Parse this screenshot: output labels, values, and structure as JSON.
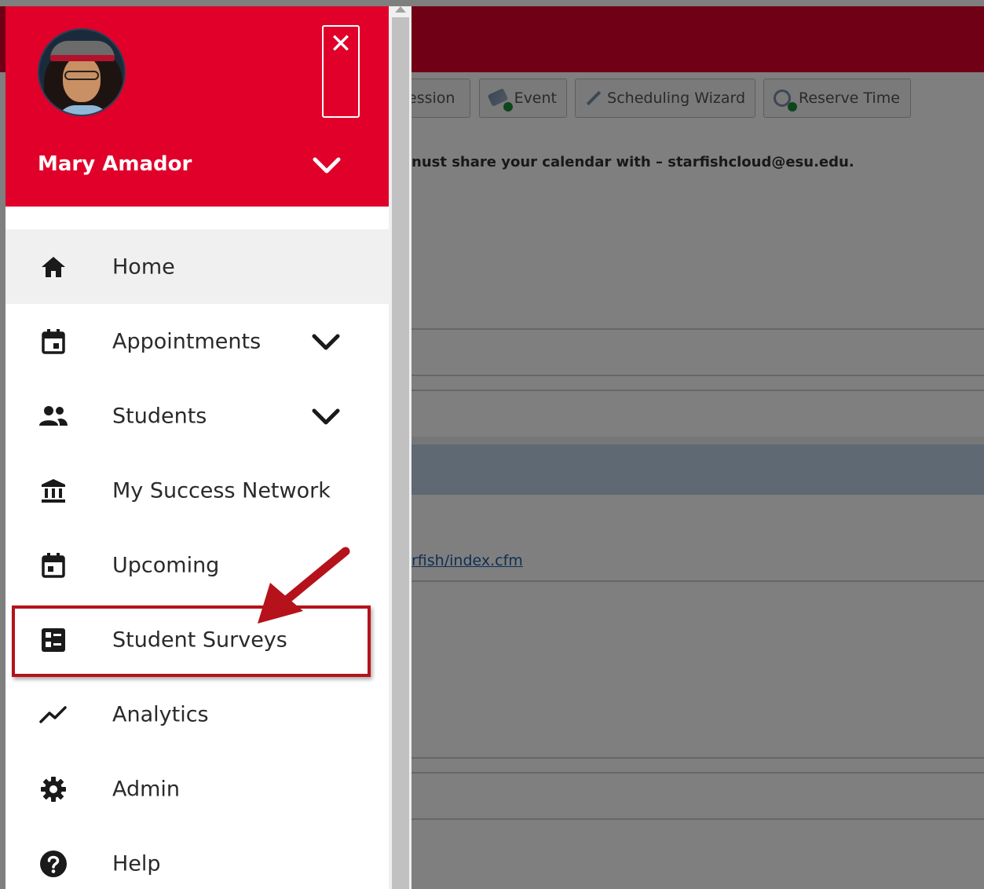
{
  "background": {
    "toolbar": [
      {
        "label": "ession",
        "icon": "session-icon"
      },
      {
        "label": "Event",
        "icon": "event-icon"
      },
      {
        "label": "Scheduling Wizard",
        "icon": "wand-icon"
      },
      {
        "label": "Reserve Time",
        "icon": "clock-add-icon"
      }
    ],
    "message": "nust share your calendar with – starfishcloud@esu.edu.",
    "link": "rfish/index.cfm"
  },
  "drawer": {
    "user_name": "Mary Amador",
    "close_symbol": "✕",
    "items": [
      {
        "label": "Home",
        "icon": "home-icon",
        "expandable": false,
        "active": true
      },
      {
        "label": "Appointments",
        "icon": "calendar-icon",
        "expandable": true,
        "active": false
      },
      {
        "label": "Students",
        "icon": "people-icon",
        "expandable": true,
        "active": false
      },
      {
        "label": "My Success Network",
        "icon": "institution-icon",
        "expandable": false,
        "active": false
      },
      {
        "label": "Upcoming",
        "icon": "calendar-today-icon",
        "expandable": false,
        "active": false
      },
      {
        "label": "Student Surveys",
        "icon": "survey-icon",
        "expandable": false,
        "active": false
      },
      {
        "label": "Analytics",
        "icon": "trend-icon",
        "expandable": false,
        "active": false
      },
      {
        "label": "Admin",
        "icon": "gear-icon",
        "expandable": false,
        "active": false
      },
      {
        "label": "Help",
        "icon": "help-icon",
        "expandable": false,
        "active": false
      }
    ]
  },
  "colors": {
    "brand_red": "#e0002a",
    "annotation_red": "#b5121b",
    "active_item_bg": "#f0f0f0"
  }
}
